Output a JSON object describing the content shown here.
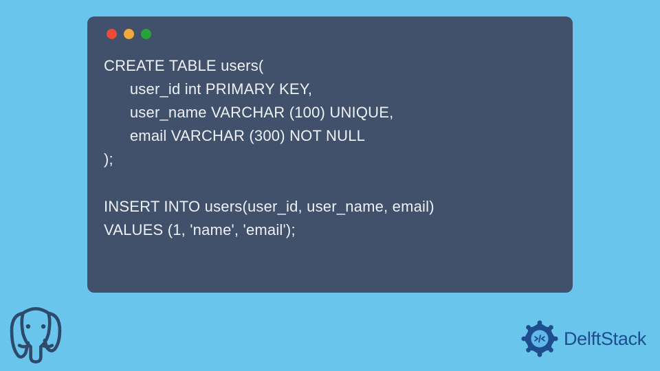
{
  "code": {
    "lines": [
      "CREATE TABLE users(",
      "      user_id int PRIMARY KEY,",
      "      user_name VARCHAR (100) UNIQUE,",
      "      email VARCHAR (300) NOT NULL",
      ");",
      "",
      "INSERT INTO users(user_id, user_name, email)",
      "VALUES (1, 'name', 'email');"
    ]
  },
  "window": {
    "dots": [
      "red",
      "yellow",
      "green"
    ]
  },
  "brand": {
    "name": "DelftStack"
  },
  "colors": {
    "background": "#6ac5ed",
    "window": "#41506b",
    "code_text": "#eef1f5",
    "brand_blue": "#1d4d8c"
  }
}
